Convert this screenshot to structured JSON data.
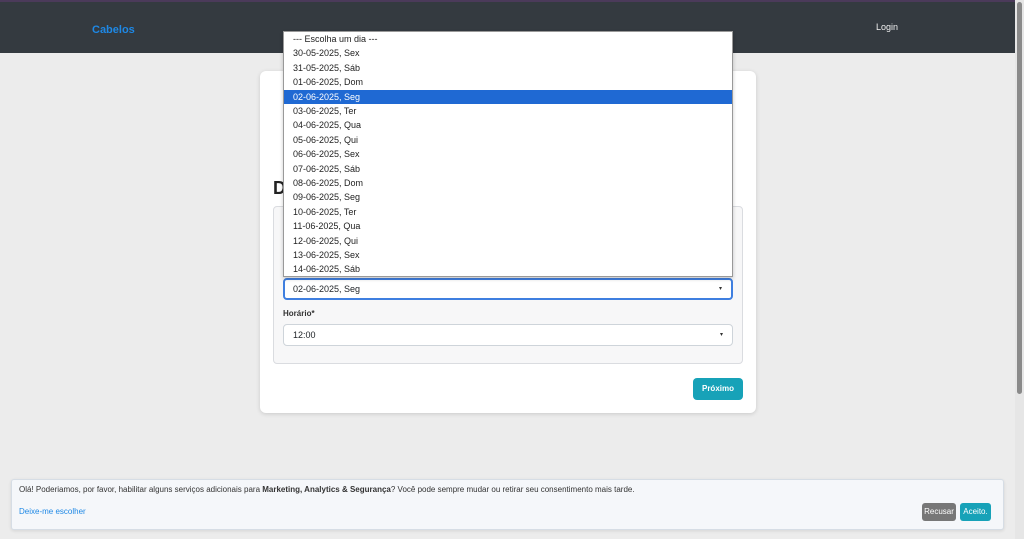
{
  "navbar": {
    "brand": "Cabelos",
    "login": "Login"
  },
  "card": {
    "heading_partial": "D",
    "day_select": {
      "selected": "02-06-2025, Seg"
    },
    "time_label": "Horário*",
    "time_select": {
      "selected": "12:00"
    },
    "next_button": "Próximo"
  },
  "dropdown": {
    "options": [
      "--- Escolha um dia ---",
      "30-05-2025, Sex",
      "31-05-2025, Sáb",
      "01-06-2025, Dom",
      "02-06-2025, Seg",
      "03-06-2025, Ter",
      "04-06-2025, Qua",
      "05-06-2025, Qui",
      "06-06-2025, Sex",
      "07-06-2025, Sáb",
      "08-06-2025, Dom",
      "09-06-2025, Seg",
      "10-06-2025, Ter",
      "11-06-2025, Qua",
      "12-06-2025, Qui",
      "13-06-2025, Sex",
      "14-06-2025, Sáb"
    ],
    "selected_index": 4
  },
  "cookie": {
    "text_before": "Olá! Poderiamos, por favor, habilitar alguns serviços adicionais para ",
    "text_bold": "Marketing, Analytics & Segurança",
    "text_after": "? Você pode sempre mudar ou retirar seu consentimento mais tarde.",
    "choose_link": "Deixe-me escolher",
    "decline_button": "Recusar",
    "accept_button": "Aceito."
  },
  "icons": {
    "caret": "▾"
  },
  "colors": {
    "navbar_bg": "#343a40",
    "brand": "#1e88e5",
    "accent": "#17a2b8",
    "selected_option": "#1f69d3"
  }
}
